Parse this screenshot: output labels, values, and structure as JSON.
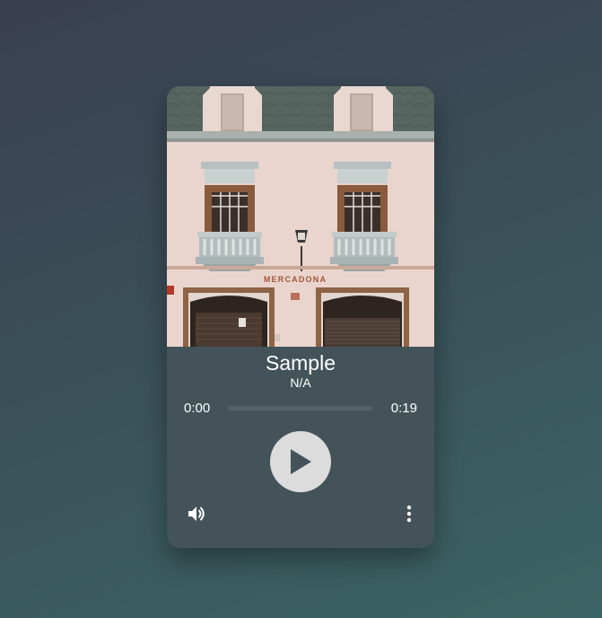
{
  "track": {
    "title": "Sample",
    "artist": "N/A"
  },
  "progress": {
    "current": "0:00",
    "total": "0:19",
    "fraction": 0
  },
  "artwork": {
    "sign_text": "MERCADONA"
  },
  "icons": {
    "play": "play-icon",
    "volume": "volume-icon",
    "menu": "more-vertical-icon"
  },
  "colors": {
    "card": "#435359",
    "play_button": "#dcdcdc",
    "track": "#536267"
  }
}
